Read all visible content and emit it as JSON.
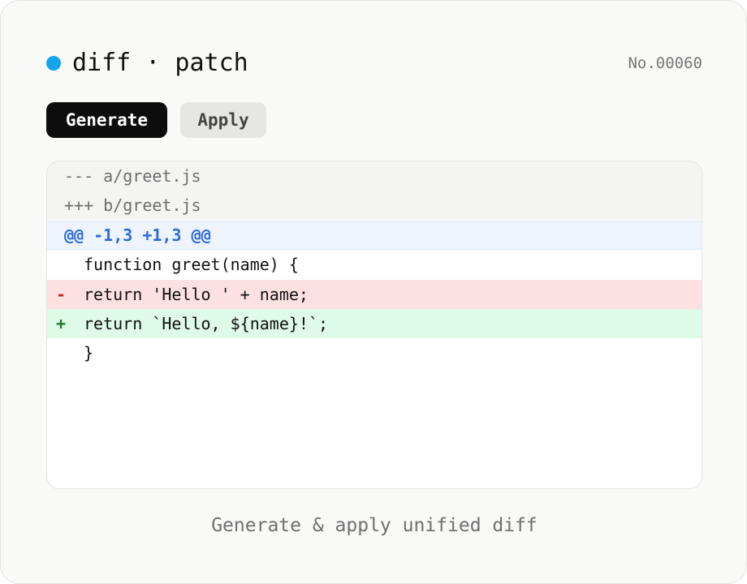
{
  "header": {
    "title": "diff · patch",
    "serial": "No.00060",
    "status_color": "#14a4ec",
    "status_icon": "status-dot-icon"
  },
  "toolbar": {
    "generate_label": "Generate",
    "apply_label": "Apply"
  },
  "diff": {
    "old_file": "--- a/greet.js",
    "new_file": "+++ b/greet.js",
    "hunk": "@@ -1,3 +1,3 @@",
    "lines": [
      {
        "type": "context",
        "marker": "",
        "code": "function greet(name) {"
      },
      {
        "type": "removed",
        "marker": "-",
        "code": "return 'Hello ' + name;"
      },
      {
        "type": "added",
        "marker": "+",
        "code": "return `Hello, ${name}!`;"
      },
      {
        "type": "context",
        "marker": "",
        "code": "}"
      }
    ],
    "colors": {
      "removed_bg": "#fde1e1",
      "added_bg": "#defbe7",
      "hunk_text": "#2b6ad8"
    }
  },
  "footer": {
    "caption": "Generate & apply unified diff"
  }
}
